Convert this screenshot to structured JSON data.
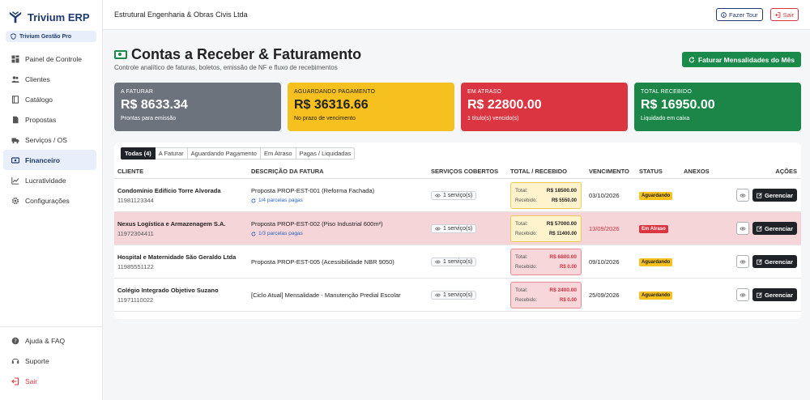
{
  "brand": {
    "name": "Trivium ERP",
    "workspace": "Trivium Gestão Pro"
  },
  "sidebar": {
    "items": [
      {
        "label": "Painel de Controle",
        "icon": "grid-icon"
      },
      {
        "label": "Clientes",
        "icon": "users-icon"
      },
      {
        "label": "Catálogo",
        "icon": "book-icon"
      },
      {
        "label": "Propostas",
        "icon": "document-icon"
      },
      {
        "label": "Serviços / OS",
        "icon": "truck-icon"
      },
      {
        "label": "Financeiro",
        "icon": "cash-icon"
      },
      {
        "label": "Lucratividade",
        "icon": "chart-icon"
      },
      {
        "label": "Configurações",
        "icon": "gear-icon"
      }
    ],
    "bottom": [
      {
        "label": "Ajuda & FAQ",
        "icon": "help-icon"
      },
      {
        "label": "Suporte",
        "icon": "headset-icon"
      },
      {
        "label": "Sair",
        "icon": "logout-icon"
      }
    ]
  },
  "topbar": {
    "company": "Estrutural Engenharia & Obras Civis Ltda",
    "tour_label": "Fazer Tour",
    "exit_label": "Sair"
  },
  "page": {
    "title": "Contas a Receber & Faturamento",
    "subtitle": "Controle analítico de faturas, boletos, emissão de NF e fluxo de recebimentos",
    "bill_button": "Faturar Mensalidades do Mês"
  },
  "cards": [
    {
      "label": "A Faturar",
      "value": "R$ 8633.34",
      "note": "Prontas para emissão",
      "color": "#6c737d"
    },
    {
      "label": "Aguardando Pagamento",
      "value": "R$ 36316.66",
      "note": "No prazo de vencimento",
      "color": "#f6c01e"
    },
    {
      "label": "Em Atraso",
      "value": "R$ 22800.00",
      "note": "1 título(s) vencido(s)",
      "color": "#db3541"
    },
    {
      "label": "Total Recebido",
      "value": "R$ 16950.00",
      "note": "Liquidado em caixa",
      "color": "#1c8648"
    }
  ],
  "tabs": [
    "Todas (4)",
    "A Faturar",
    "Aguardando Pagamento",
    "Em Atraso",
    "Pagas / Liquidadas"
  ],
  "table": {
    "headers": [
      "CLIENTE",
      "DESCRIÇÃO DA FATURA",
      "SERVIÇOS COBERTOS",
      "TOTAL / RECEBIDO",
      "VENCIMENTO",
      "STATUS",
      "ANEXOS",
      "AÇÕES"
    ],
    "total_label": "Total:",
    "received_label": "Recebido:",
    "manage_label": "Gerenciar",
    "rows": [
      {
        "client": "Condomínio Edifício Torre Alvorada",
        "phone": "11981123344",
        "desc": "Proposta PROP-EST-001 (Reforma Fachada)",
        "parcelas": "1/4 parcelas pagas",
        "services": "1 serviço(s)",
        "total": "R$ 18500.00",
        "received": "R$ 5550.00",
        "due": "03/10/2026",
        "status": "Aguardando"
      },
      {
        "client": "Nexus Logística e Armazenagem S.A.",
        "phone": "11972304411",
        "desc": "Proposta PROP-EST-002 (Piso Industrial 600m²)",
        "parcelas": "1/3 parcelas pagas",
        "services": "1 serviço(s)",
        "total": "R$ 57000.00",
        "received": "R$ 11400.00",
        "due": "13/09/2026",
        "status": "Em Atraso"
      },
      {
        "client": "Hospital e Maternidade São Geraldo Ltda",
        "phone": "11985551122",
        "desc": "Proposta PROP-EST-005 (Acessibilidade NBR 9050)",
        "parcelas": "",
        "services": "1 serviço(s)",
        "total": "R$ 6800.00",
        "received": "R$ 0.00",
        "due": "09/10/2026",
        "status": "Aguardando"
      },
      {
        "client": "Colégio Integrado Objetivo Suzano",
        "phone": "11971110022",
        "desc": "[Ciclo Atual] Mensalidade - Manutenção Predial Escolar",
        "parcelas": "",
        "services": "1 serviço(s)",
        "total": "R$ 2400.00",
        "received": "R$ 0.00",
        "due": "25/09/2026",
        "status": "Aguardando"
      }
    ]
  }
}
